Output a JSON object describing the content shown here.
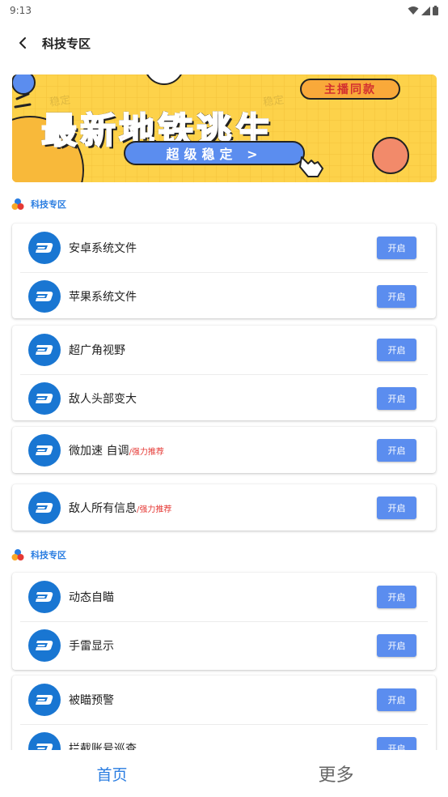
{
  "status": {
    "time": "9:13"
  },
  "header": {
    "title": "科技专区"
  },
  "banner": {
    "headline": "最新地铁逃生",
    "tag": "主播同款",
    "pill": "超级稳定 >",
    "watermark": "稳定"
  },
  "sections": [
    {
      "title": "科技专区"
    },
    {
      "title": "科技专区"
    }
  ],
  "cards": [
    {
      "rows": [
        {
          "label": "安卓系统文件",
          "button": "开启"
        },
        {
          "label": "苹果系统文件",
          "button": "开启"
        }
      ]
    },
    {
      "rows": [
        {
          "label": "超广角视野",
          "button": "开启"
        },
        {
          "label": "敌人头部变大",
          "button": "开启"
        }
      ]
    },
    {
      "rows": [
        {
          "label": "微加速 自调",
          "sub": "/强力推荐",
          "button": "开启"
        }
      ]
    },
    {
      "rows": [
        {
          "label": "敌人所有信息",
          "sub": "/强力推荐",
          "button": "开启"
        }
      ]
    },
    {
      "rows": [
        {
          "label": "动态自瞄",
          "button": "开启"
        },
        {
          "label": "手雷显示",
          "button": "开启"
        }
      ]
    },
    {
      "rows": [
        {
          "label": "被瞄预警",
          "button": "开启"
        },
        {
          "label": "拦截账号巡查",
          "button": "开启"
        }
      ]
    }
  ],
  "nav": {
    "home": "首页",
    "more": "更多"
  },
  "colors": {
    "accent": "#2a7de1",
    "button": "#5b8def",
    "icon": "#1976d2",
    "highlight": "#e53935",
    "banner": "#fdd24a"
  }
}
